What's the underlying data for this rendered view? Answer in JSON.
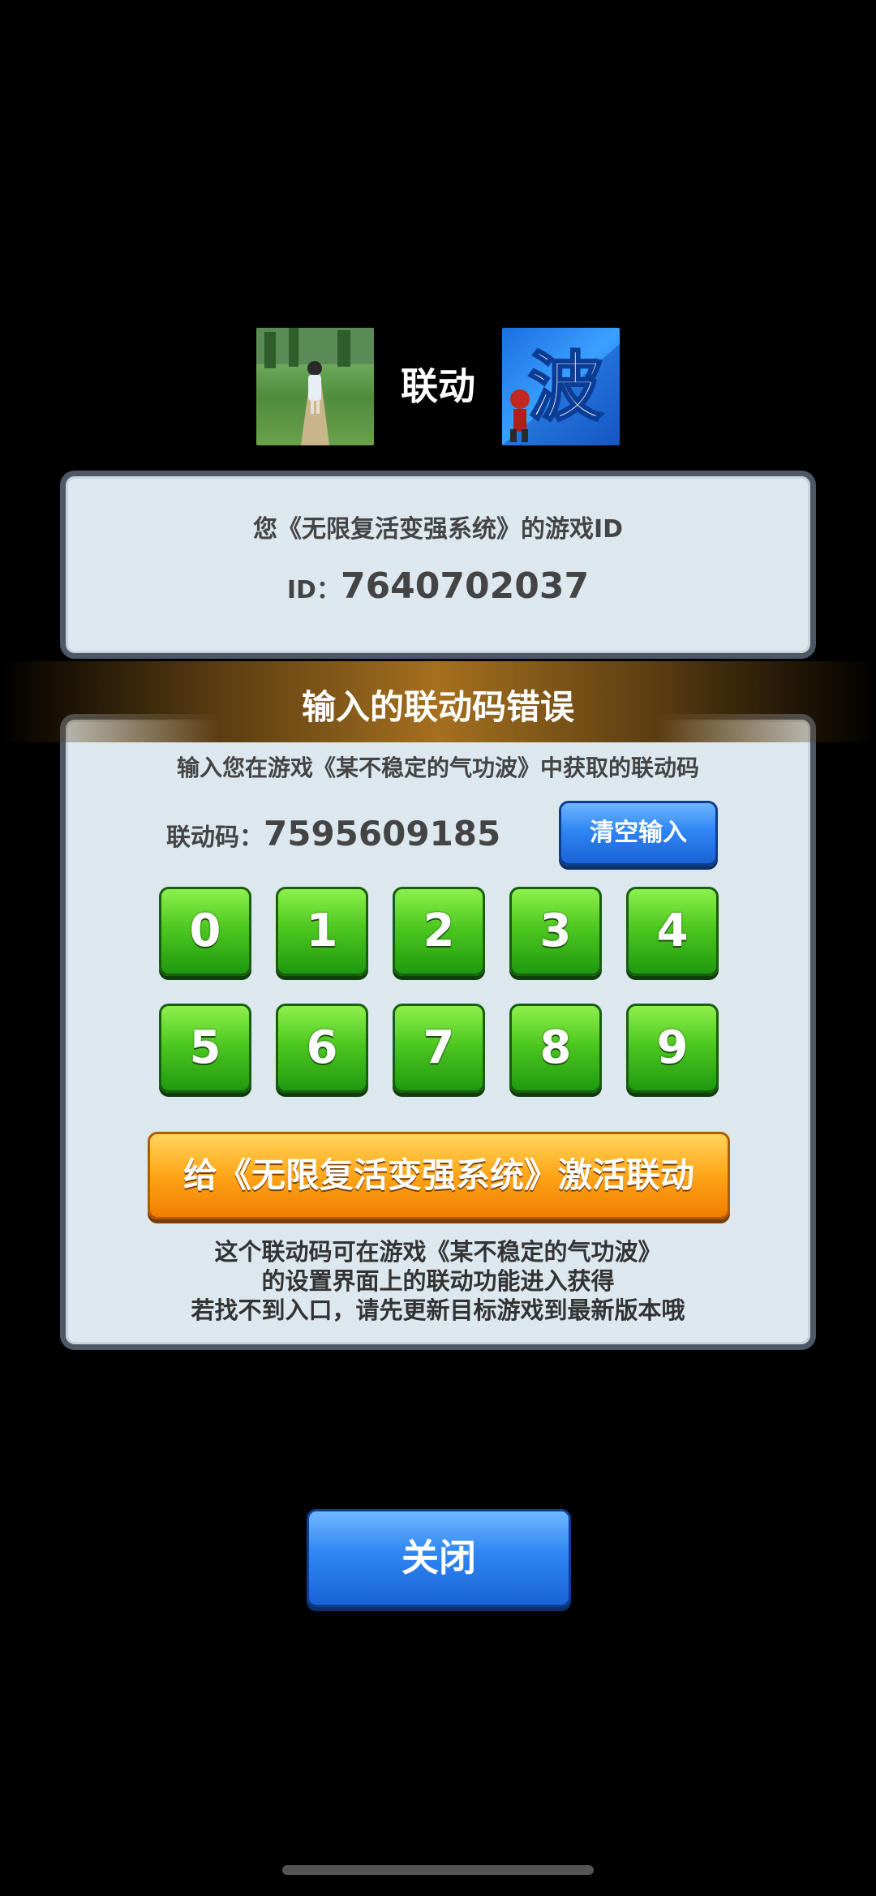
{
  "header": {
    "link_word": "联动",
    "left_icon": "game-icon-girl-on-path",
    "right_icon": "game-icon-bo-character"
  },
  "id_panel": {
    "title": "您《无限复活变强系统》的游戏ID",
    "id_label": "ID：",
    "id_value": "7640702037"
  },
  "banner": {
    "error_text": "输入的联动码错误"
  },
  "main": {
    "instruction": "输入您在游戏《某不稳定的气功波》中获取的联动码",
    "code_label": "联动码：",
    "code_value": "7595609185",
    "clear_button": "清空输入",
    "digits_row1": [
      "0",
      "1",
      "2",
      "3",
      "4"
    ],
    "digits_row2": [
      "5",
      "6",
      "7",
      "8",
      "9"
    ],
    "activate_button": "给《无限复活变强系统》激活联动",
    "notes": [
      "这个联动码可在游戏《某不稳定的气功波》",
      "的设置界面上的联动功能进入获得",
      "若找不到入口，请先更新目标游戏到最新版本哦"
    ]
  },
  "footer": {
    "close_button": "关闭"
  },
  "colors": {
    "panel_bg": "#dde8ee",
    "panel_border": "#4d5766",
    "green": "#4ec820",
    "blue": "#2f86f2",
    "orange": "#ffa518"
  }
}
